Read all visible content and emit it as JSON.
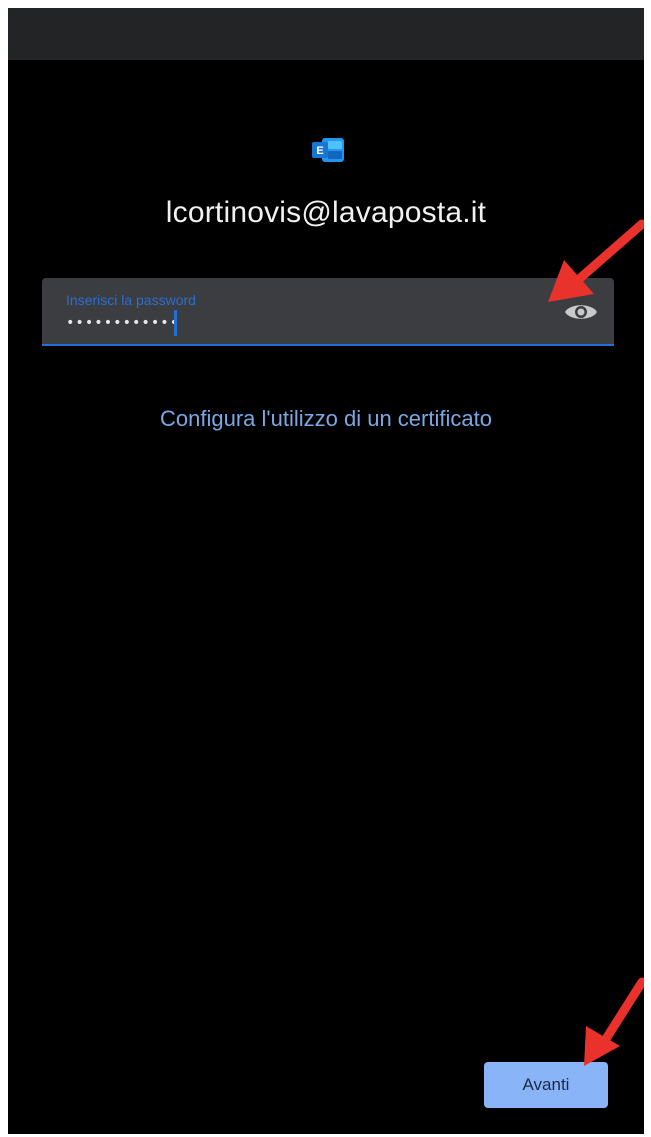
{
  "account": {
    "email": "lcortinovis@lavaposta.it"
  },
  "password_field": {
    "label": "Inserisci la password",
    "value": "••••••••••••"
  },
  "certificate_link": {
    "label": "Configura l'utilizzo di un certificato"
  },
  "next_button": {
    "label": "Avanti"
  },
  "icons": {
    "app": "exchange-logo-icon",
    "toggle_visibility": "eye-icon",
    "annotation": "arrow-icon"
  },
  "colors": {
    "background": "#000000",
    "status_bar": "#232426",
    "field_background": "#3b3d40",
    "accent": "#1f6fd6",
    "link": "#7aa8e6",
    "button": "#8ab4f8",
    "annotation_arrow": "#e8322b"
  }
}
